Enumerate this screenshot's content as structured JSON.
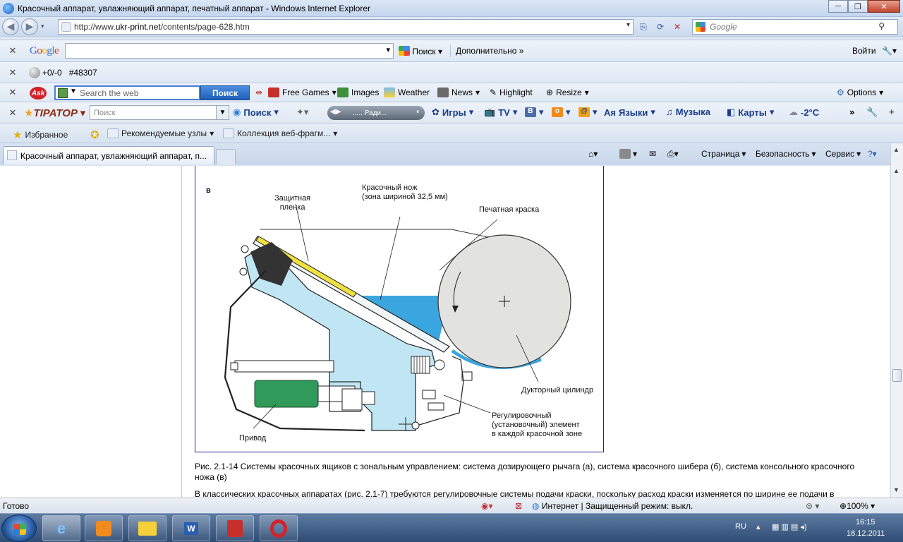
{
  "window": {
    "title": "Красочный аппарат, увлажняющий аппарат, печатный аппарат - Windows Internet Explorer"
  },
  "address_bar": {
    "url_prefix": "http://www.",
    "url_host": "ukr-print.net",
    "url_path": "/contents/page-628.htm",
    "search_placeholder": "Google"
  },
  "google_toolbar": {
    "logo": "Google",
    "search_label": "Поиск",
    "more_label": "Дополнительно »",
    "login_label": "Войти"
  },
  "counter_toolbar": {
    "score": "+0/-0",
    "id": "#48307"
  },
  "ask_toolbar": {
    "logo": "Ask",
    "placeholder": "Search the web",
    "search_button": "Поиск",
    "items": [
      "Free Games",
      "Images",
      "Weather",
      "News",
      "Highlight",
      "Resize"
    ],
    "options": "Options"
  },
  "tiptop_toolbar": {
    "logo": "TIPATOP",
    "placeholder": "Поиск",
    "search_label": "Поиск",
    "radio_label": "..... Ради...",
    "items": [
      "Игры",
      "TV",
      "Языки",
      "Музыка",
      "Карты"
    ],
    "temperature": "-2°C"
  },
  "favorites_bar": {
    "favorites": "Избранное",
    "items": [
      "Рекомендуемые узлы",
      "Коллекция веб-фрагм..."
    ]
  },
  "tab": {
    "title": "Красочный аппарат, увлажняющий аппарат, п..."
  },
  "command_bar": {
    "page": "Страница",
    "safety": "Безопасность",
    "tools": "Сервис"
  },
  "figure": {
    "label_letter": "в",
    "labels": {
      "film": "Защитная\nпленка",
      "knife": "Красочный нож\n(зона шириной 32,5 мм)",
      "ink": "Печатная краска",
      "cylinder": "Дукторный цилиндр",
      "element": "Регулировочный\n(установочный) элемент\nв каждой красочной зоне",
      "drive": "Привод"
    }
  },
  "caption": "Рис. 2.1-14 Системы красочных ящиков с зональным управлением: система дозирующего рычага (а), система красочного шибера (б), система консольного красочного ножа (в)",
  "paragraph": "В классических красочных аппаратах (рис. 2.1-7) требуются регулировочные системы подачи краски, поскольку расход краски изменяется по ширине ее подачи в",
  "status_bar": {
    "ready": "Готово",
    "zone": "Интернет | Защищенный режим: выкл.",
    "zoom": "100%"
  },
  "taskbar": {
    "lang": "RU",
    "time": "16:15",
    "date": "18.12.2011"
  },
  "colors": {
    "fig_border": "#23238c",
    "machine_blue": "#bfe6f2",
    "ink_blue": "#3aa6e0",
    "cylinder_gray": "#e2e2e0",
    "motor_green": "#2f9a5a",
    "film_yellow": "#f0e040"
  }
}
